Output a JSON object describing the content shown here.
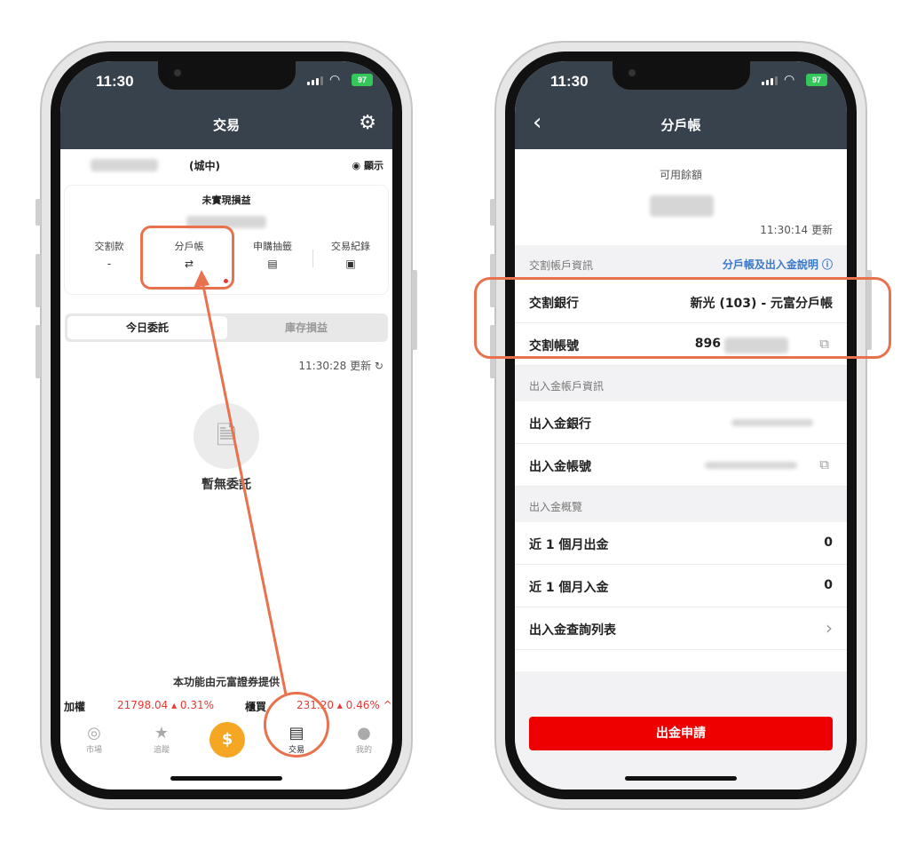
{
  "left": {
    "status": {
      "time": "11:30",
      "battery": "97"
    },
    "nav": {
      "title": "交易"
    },
    "account": {
      "branch": "(城中)",
      "show_label": "顯示"
    },
    "pnl": {
      "title": "未實現損益",
      "shortcuts": [
        {
          "label": "交割款",
          "value": "-"
        },
        {
          "label": "分戶帳",
          "value": "⇄"
        },
        {
          "label": "申購抽籤",
          "value": "▤"
        },
        {
          "label": "交易紀錄",
          "value": "▣"
        }
      ]
    },
    "segment": {
      "tab_a": "今日委託",
      "tab_b": "庫存損益"
    },
    "update": {
      "text": "11:30:28 更新 ↻"
    },
    "empty": {
      "text": "暫無委託"
    },
    "provider": "本功能由元富證券提供",
    "ticker": {
      "label1": "加權",
      "value1": "21798.04 ▴ 0.31%",
      "label2": "櫃買",
      "value2": "231.20 ▴ 0.46% ^"
    },
    "tabs": [
      {
        "label": "市場",
        "icon": "compass-icon"
      },
      {
        "label": "追蹤",
        "icon": "star-icon"
      },
      {
        "label": "交易",
        "icon": "document-icon"
      },
      {
        "label": "我的",
        "icon": "person-icon"
      }
    ],
    "colors": {
      "accent": "#f5a623",
      "up": "#e53935",
      "annotation": "#e8714e"
    }
  },
  "right": {
    "status": {
      "time": "11:30",
      "battery": "97"
    },
    "nav": {
      "title": "分戶帳"
    },
    "balance": {
      "label": "可用餘額",
      "updated": "11:30:14 更新"
    },
    "settlement": {
      "section": "交割帳戶資訊",
      "help_link": "分戶帳及出入金說明 ⓘ",
      "bank_label": "交割銀行",
      "bank_value": "新光 (103) - 元富分戶帳",
      "account_label": "交割帳號",
      "account_prefix": "896"
    },
    "transfer": {
      "section": "出入金帳戶資訊",
      "bank_label": "出入金銀行",
      "account_label": "出入金帳號"
    },
    "overview": {
      "section": "出入金概覽",
      "withdraw_label": "近 1 個月出金",
      "withdraw_value": "0",
      "deposit_label": "近 1 個月入金",
      "deposit_value": "0",
      "query_label": "出入金查詢列表"
    },
    "withdraw_button": "出金申請"
  }
}
